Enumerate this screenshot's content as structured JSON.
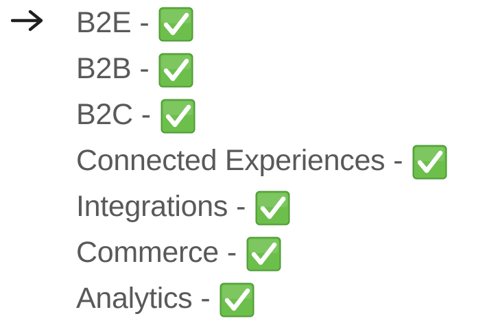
{
  "bullet_icon": "right-arrow-icon",
  "check_icon": "green-check-box-icon",
  "colors": {
    "text": "#595959",
    "arrow": "#1f1f1f",
    "check_bg": "#6cbf4b",
    "check_border": "#4e9b35",
    "check_mark": "#ffffff"
  },
  "items": [
    {
      "label": "B2E",
      "separator": "-"
    },
    {
      "label": "B2B",
      "separator": "-"
    },
    {
      "label": "B2C",
      "separator": "-"
    },
    {
      "label": "Connected Experiences",
      "separator": "-"
    },
    {
      "label": "Integrations",
      "separator": "-"
    },
    {
      "label": "Commerce",
      "separator": "-"
    },
    {
      "label": "Analytics",
      "separator": "-"
    }
  ]
}
